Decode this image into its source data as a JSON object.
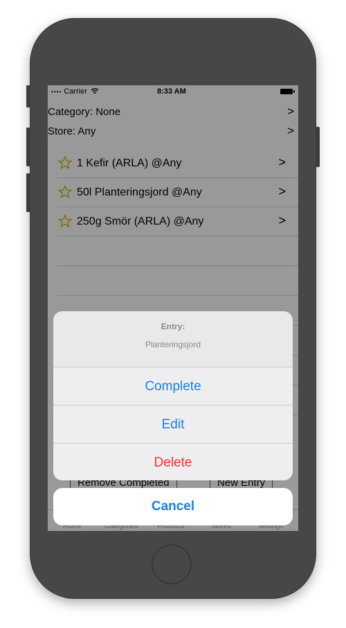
{
  "status_bar": {
    "carrier": "Carrier",
    "time": "8:33 AM"
  },
  "filters": {
    "category": "Category: None",
    "store": "Store: Any",
    "chevron": ">"
  },
  "entries": [
    {
      "label": "1  Kefir (ARLA)  @Any"
    },
    {
      "label": "50l  Planteringsjord  @Any"
    },
    {
      "label": "250g  Smör (ARLA)  @Any"
    }
  ],
  "bottom_buttons": {
    "remove_completed": "Remove Completed",
    "new_entry": "New Entry"
  },
  "tabs": [
    "Home",
    "Categories",
    "Products",
    "Stores",
    "Settings"
  ],
  "action_sheet": {
    "title": "Entry:",
    "message": "Planteringsjord",
    "complete": "Complete",
    "edit": "Edit",
    "delete": "Delete",
    "cancel": "Cancel"
  },
  "colors": {
    "accent": "#1a7fe8",
    "destructive": "#ff2d2d",
    "star": "#d4b400",
    "phone_body": "#474747"
  },
  "icons": [
    "wifi-icon",
    "battery-icon",
    "star-icon",
    "chevron-right-icon",
    "home-button"
  ]
}
